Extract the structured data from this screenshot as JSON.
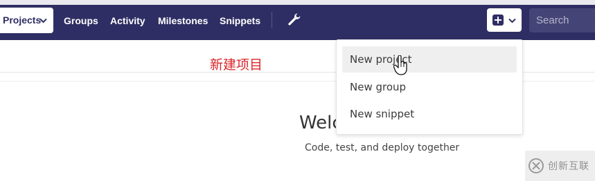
{
  "navbar": {
    "projects_label": "Projects",
    "links": [
      "Groups",
      "Activity",
      "Milestones",
      "Snippets"
    ],
    "admin_icon": "wrench-icon",
    "new_icon": "plus-square-icon",
    "search_placeholder": "Search"
  },
  "annotation": "新建项目",
  "dropdown": {
    "items": [
      "New project",
      "New group",
      "New snippet"
    ],
    "active_index": 0
  },
  "welcome": {
    "heading": "Welc",
    "tagline": "Code, test, and deploy together"
  },
  "watermark": {
    "text": "创新互联",
    "icon": "brand-logo-icon"
  },
  "colors": {
    "navbar_bg": "#2f2e64",
    "annotation_red": "#d9262a",
    "hover_bg": "#efefef"
  }
}
